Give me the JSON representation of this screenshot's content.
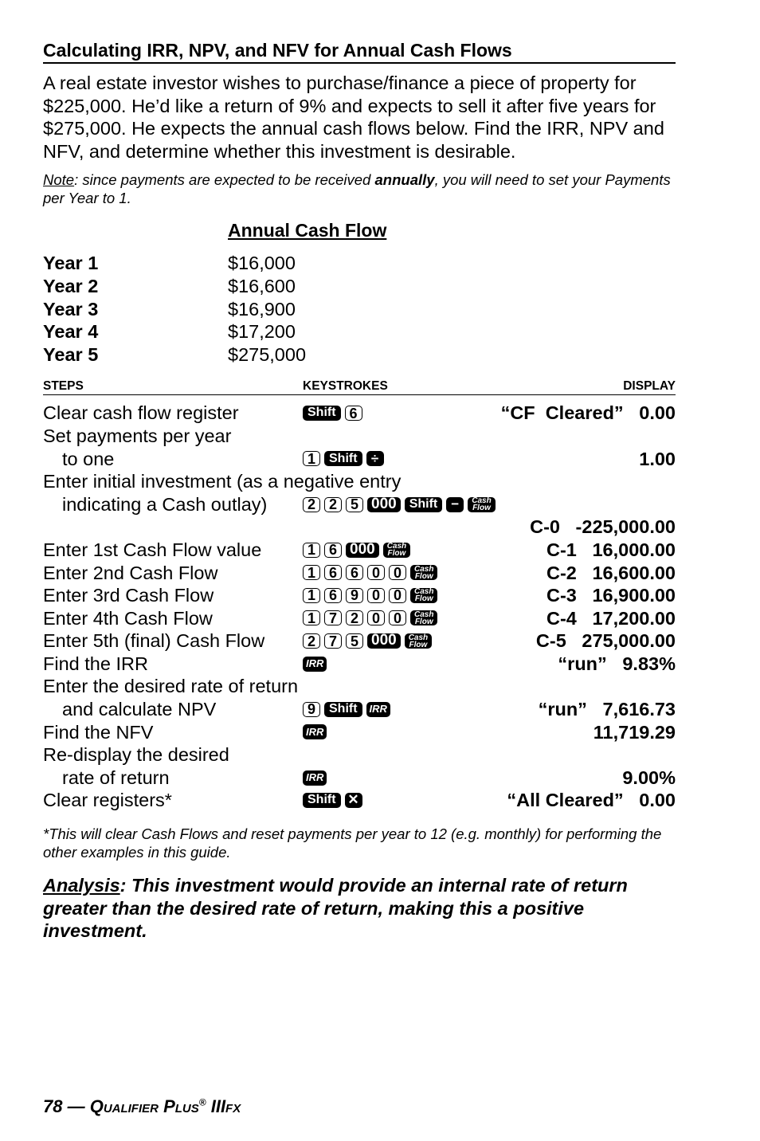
{
  "title": "Calculating IRR, NPV, and NFV for Annual Cash Flows",
  "intro": "A real estate investor wishes to purchase/finance a piece of property for $225,000. He’d like a return of 9% and expects to sell it after five years for $275,000. He expects the annual cash flows below. Find the IRR, NPV and NFV, and determine whether this investment is desirable.",
  "note": {
    "label": "Note",
    "text_before": ": since payments are expected to be received ",
    "bold": "annually",
    "text_after": ", you will need to set your Payments per Year to 1."
  },
  "cash_flow": {
    "heading": "Annual Cash Flow",
    "rows": [
      {
        "year": "Year 1",
        "amount": "$16,000"
      },
      {
        "year": "Year 2",
        "amount": "$16,600"
      },
      {
        "year": "Year 3",
        "amount": "$16,900"
      },
      {
        "year": "Year 4",
        "amount": "$17,200"
      },
      {
        "year": "Year 5",
        "amount": "$275,000"
      }
    ]
  },
  "steps_table": {
    "headers": {
      "steps": "STEPS",
      "keystrokes": "KEYSTROKES",
      "display": "DISPLAY"
    },
    "rows": [
      {
        "step": "Clear cash flow register",
        "display": "“CF  Cleared”   0.00"
      },
      {
        "step": "Set payments per year",
        "display": ""
      },
      {
        "step": "to one",
        "display": "1.00"
      },
      {
        "step": "Enter initial investment (as a negative entry",
        "display": ""
      },
      {
        "step": "indicating a Cash outlay)",
        "display": ""
      },
      {
        "step": "",
        "display": "C-0   -225,000.00"
      },
      {
        "step": "Enter 1st Cash Flow value",
        "display": "C-1   16,000.00"
      },
      {
        "step": "Enter 2nd Cash Flow",
        "display": "C-2   16,600.00"
      },
      {
        "step": "Enter 3rd Cash Flow",
        "display": "C-3   16,900.00"
      },
      {
        "step": "Enter 4th Cash Flow",
        "display": "C-4   17,200.00"
      },
      {
        "step": "Enter 5th (final) Cash Flow",
        "display": "C-5   275,000.00"
      },
      {
        "step": "Find the IRR",
        "display": "“run”   9.83%"
      },
      {
        "step": "Enter the desired rate of return",
        "display": ""
      },
      {
        "step": "and calculate NPV",
        "display": "“run”   7,616.73"
      },
      {
        "step": "Find the NFV",
        "display": "11,719.29"
      },
      {
        "step": "Re-display the desired",
        "display": ""
      },
      {
        "step": "rate of return",
        "display": "9.00%"
      },
      {
        "step": "Clear registers*",
        "display": "“All Cleared”   0.00"
      }
    ]
  },
  "keys": {
    "shift": "Shift",
    "zeros": "000",
    "irr": "IRR",
    "cash": "Cash",
    "flow": "Flow",
    "divide": "÷",
    "minus": "−",
    "times": "✕",
    "d0": "0",
    "d1": "1",
    "d2": "2",
    "d5": "5",
    "d6": "6",
    "d7": "7",
    "d9": "9"
  },
  "footnote": "*This will clear Cash Flows and reset payments per year to 12 (e.g. monthly) for performing the other examples in this guide.",
  "analysis": {
    "label": "Analysis",
    "text": ": This investment would provide an internal rate of return greater than the desired rate of return, making this a positive investment."
  },
  "footer": {
    "page": "78 — ",
    "product": "Qualifier Plus",
    "reg": "®",
    "model": " IIIfx"
  }
}
